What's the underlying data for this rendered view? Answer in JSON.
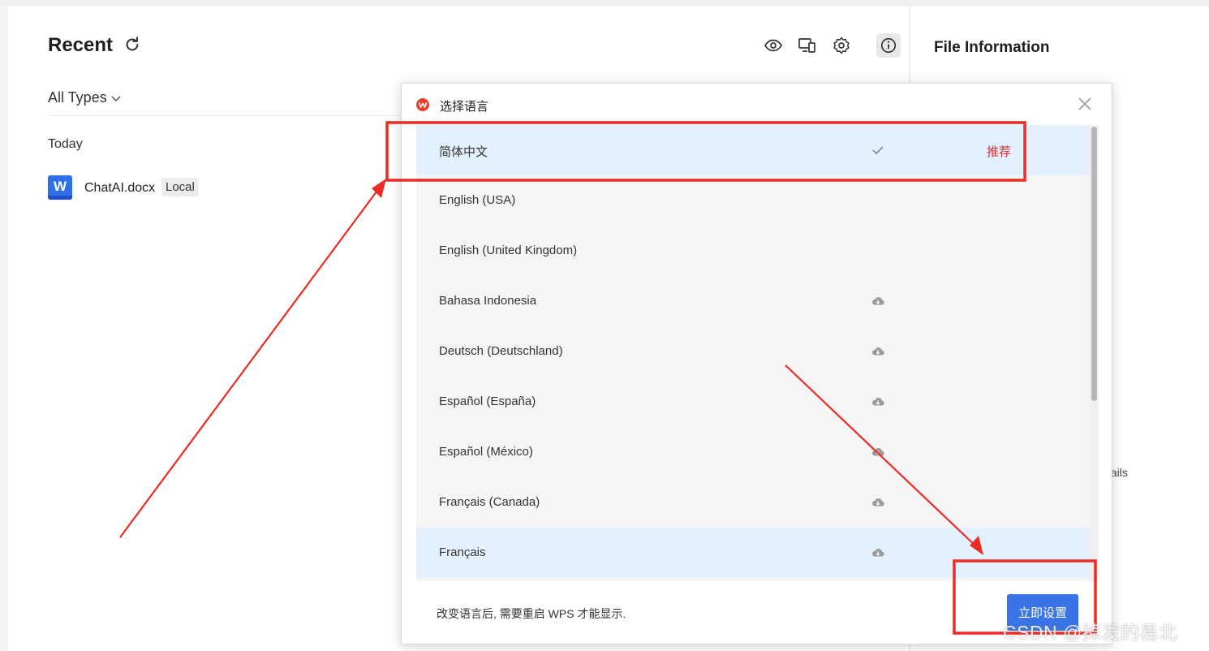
{
  "main": {
    "title": "Recent",
    "filter_label": "All Types",
    "group_label": "Today",
    "files": [
      {
        "name": "ChatAI.docx",
        "badge": "Local",
        "icon_letter": "W"
      }
    ],
    "toolbar_icons": [
      "eye-icon",
      "devices-icon",
      "gear-icon",
      "info-icon"
    ]
  },
  "right_panel": {
    "title": "File Information",
    "details_fragment": "tails"
  },
  "dialog": {
    "title": "选择语言",
    "languages": [
      {
        "name": "简体中文",
        "mark": "check",
        "recommend": "推荐",
        "selected": true
      },
      {
        "name": "English (USA)",
        "mark": "",
        "recommend": "",
        "selected": false
      },
      {
        "name": "English (United Kingdom)",
        "mark": "",
        "recommend": "",
        "selected": false
      },
      {
        "name": "Bahasa Indonesia",
        "mark": "cloud-download",
        "recommend": "",
        "selected": false
      },
      {
        "name": "Deutsch (Deutschland)",
        "mark": "cloud-download",
        "recommend": "",
        "selected": false
      },
      {
        "name": "Español (España)",
        "mark": "cloud-download",
        "recommend": "",
        "selected": false
      },
      {
        "name": "Español (México)",
        "mark": "cloud-download",
        "recommend": "",
        "selected": false
      },
      {
        "name": "Français (Canada)",
        "mark": "cloud-download",
        "recommend": "",
        "selected": false
      },
      {
        "name": "Français",
        "mark": "cloud-download",
        "recommend": "",
        "selected": true
      }
    ],
    "note": "改变语言后, 需要重启 WPS 才能显示.",
    "apply_label": "立即设置"
  },
  "watermark": "CSDN @掉发的易北",
  "colors": {
    "accent": "#3a73e5",
    "selected_row": "#e3f0fd",
    "recommend": "#d23030",
    "annotation": "#ee2a24"
  }
}
